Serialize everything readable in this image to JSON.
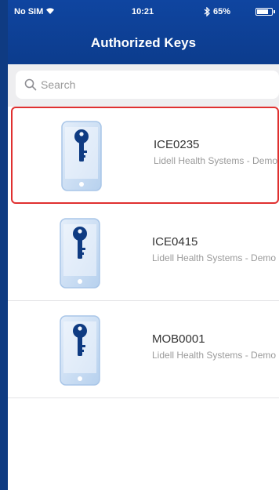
{
  "status_bar": {
    "carrier": "No SIM",
    "time": "10:21",
    "battery": "65%"
  },
  "header": {
    "title": "Authorized Keys"
  },
  "search": {
    "placeholder": "Search",
    "value": ""
  },
  "keys": [
    {
      "name": "ICE0235",
      "org": "Lidell Health Systems - Demo",
      "selected": true
    },
    {
      "name": "ICE0415",
      "org": "Lidell Health Systems - Demo",
      "selected": false
    },
    {
      "name": "MOB0001",
      "org": "Lidell Health Systems - Demo",
      "selected": false
    }
  ],
  "colors": {
    "header": "#0f45a0",
    "selection_border": "#e03030",
    "phone_fill": "#cfe2f6",
    "key_color": "#0f3b82"
  }
}
